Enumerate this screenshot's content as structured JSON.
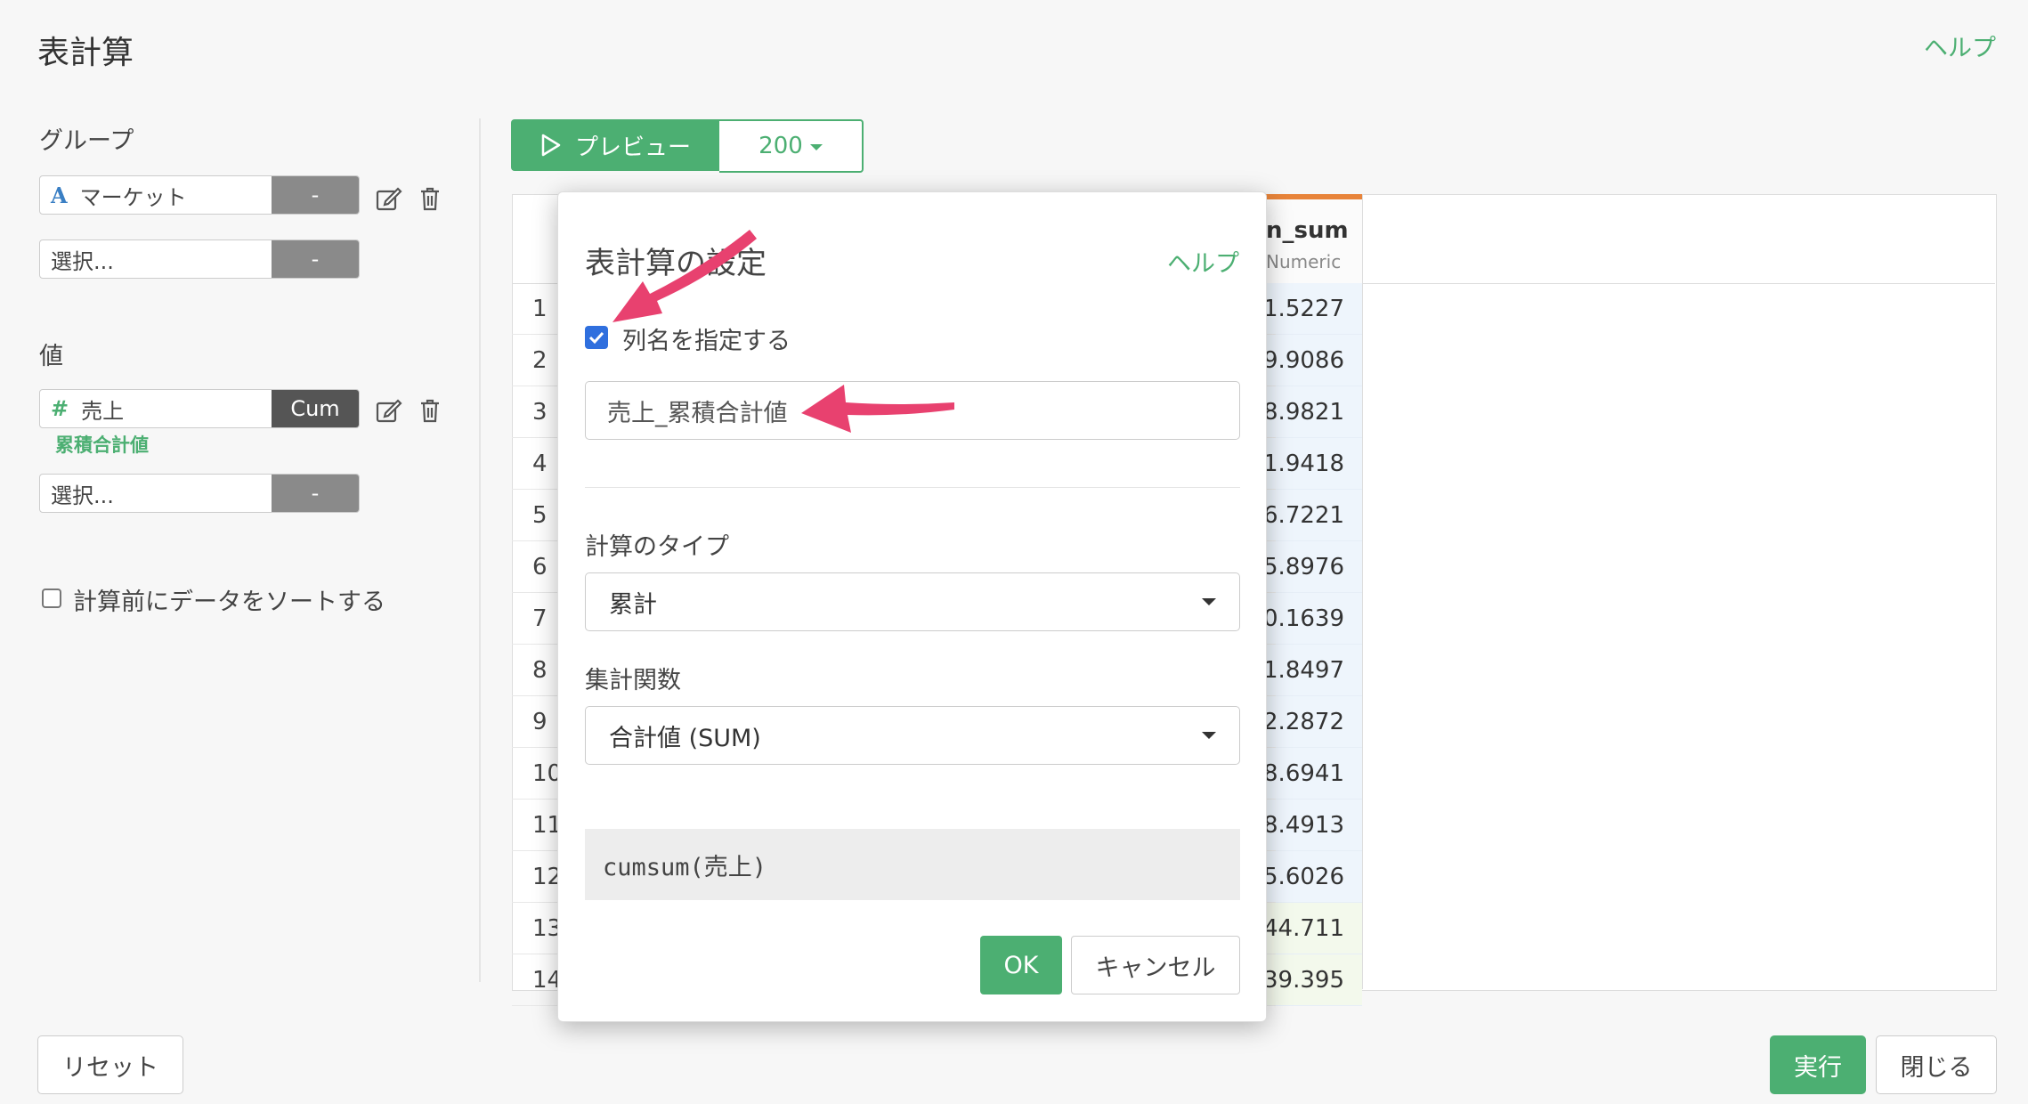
{
  "page": {
    "title": "表計算",
    "help": "ヘルプ"
  },
  "left_panel": {
    "group_label": "グループ",
    "group_fields": [
      {
        "icon": "A",
        "value": "マーケット",
        "button": "-"
      },
      {
        "value": "選択...",
        "button": "-"
      }
    ],
    "value_label": "値",
    "value_fields": [
      {
        "icon": "#",
        "value": "売上",
        "button": "Cum",
        "sublabel": "累積合計値"
      },
      {
        "value": "選択...",
        "button": "-"
      }
    ],
    "sort_checkbox_label": "計算前にデータをソートする",
    "sort_checked": false
  },
  "toolbar": {
    "preview_label": "プレビュー",
    "row_count": "200"
  },
  "table": {
    "column": {
      "name": "n_sum",
      "type": "Numeric"
    },
    "row_numbers": [
      "1",
      "2",
      "3",
      "4",
      "5",
      "6",
      "7",
      "8",
      "9",
      "10",
      "11",
      "12",
      "13",
      "14"
    ],
    "values": [
      "1.5227",
      "9.9086",
      "8.9821",
      "1.9418",
      "6.7221",
      "5.8976",
      "0.1639",
      "1.8497",
      "2.2872",
      "8.6941",
      "8.4913",
      "5.6026",
      "44.711",
      "39.395"
    ]
  },
  "modal": {
    "title": "表計算の設定",
    "help": "ヘルプ",
    "name_checkbox_label": "列名を指定する",
    "name_checked": true,
    "name_value": "売上_累積合計値",
    "calc_type_label": "計算のタイプ",
    "calc_type_value": "累計",
    "agg_label": "集計関数",
    "agg_value": "合計値 (SUM)",
    "expression": "cumsum(売上)",
    "ok_label": "OK",
    "cancel_label": "キャンセル"
  },
  "footer": {
    "reset_label": "リセット",
    "run_label": "実行",
    "close_label": "閉じる"
  },
  "colors": {
    "accent": "#4caf72",
    "annotation_arrow": "#e8416f",
    "column_header_accent": "#e8843a"
  },
  "icons": [
    "edit-icon",
    "trash-icon",
    "play-icon",
    "caret-down-icon",
    "checkmark-icon",
    "arrow-annotation"
  ]
}
